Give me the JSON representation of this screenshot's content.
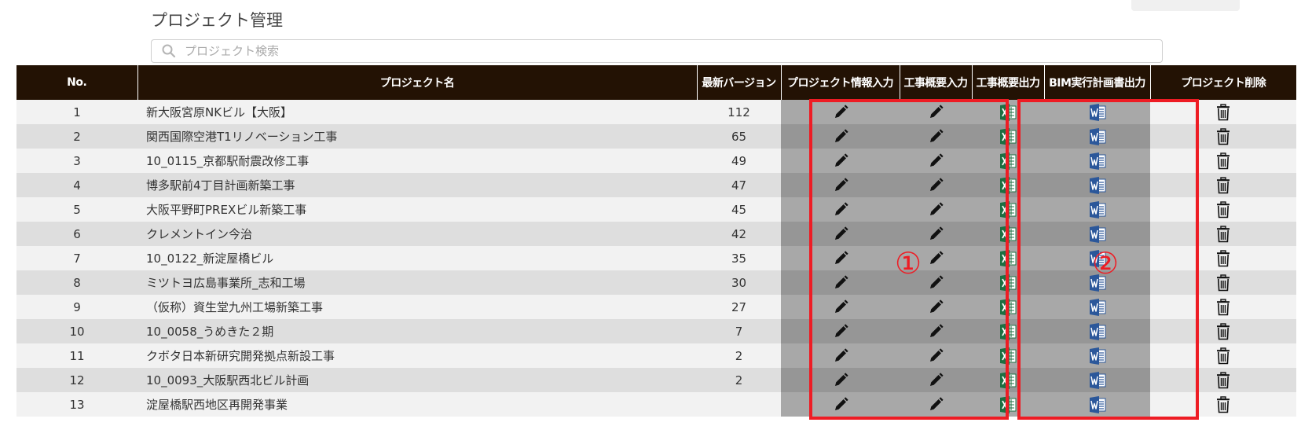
{
  "page": {
    "title": "プロジェクト管理"
  },
  "search": {
    "placeholder": "プロジェクト検索",
    "value": ""
  },
  "table": {
    "headers": {
      "no": "No.",
      "name": "プロジェクト名",
      "version": "最新バージョン",
      "project_info_input": "プロジェクト情報入力",
      "summary_input": "工事概要入力",
      "summary_output": "工事概要出力",
      "bim_plan_output": "BIM実行計画書出力",
      "delete": "プロジェクト削除"
    },
    "rows": [
      {
        "no": "1",
        "name": "新大阪宮原NKビル【大阪】",
        "version": "112"
      },
      {
        "no": "2",
        "name": "関西国際空港T1リノベーション工事",
        "version": "65"
      },
      {
        "no": "3",
        "name": "10_0115_京都駅耐震改修工事",
        "version": "49"
      },
      {
        "no": "4",
        "name": "博多駅前4丁目計画新築工事",
        "version": "47"
      },
      {
        "no": "5",
        "name": "大阪平野町PREXビル新築工事",
        "version": "45"
      },
      {
        "no": "6",
        "name": "クレメントイン今治",
        "version": "42"
      },
      {
        "no": "7",
        "name": "10_0122_新淀屋橋ビル",
        "version": "35"
      },
      {
        "no": "8",
        "name": "ミツトヨ広島事業所_志和工場",
        "version": "30"
      },
      {
        "no": "9",
        "name": "（仮称）資生堂九州工場新築工事",
        "version": "27"
      },
      {
        "no": "10",
        "name": "10_0058_うめきた２期",
        "version": "7"
      },
      {
        "no": "11",
        "name": "クボタ日本新研究開発拠点新設工事",
        "version": "2"
      },
      {
        "no": "12",
        "name": "10_0093_大阪駅西北ビル計画",
        "version": "2"
      },
      {
        "no": "13",
        "name": "淀屋橋駅西地区再開発事業",
        "version": ""
      }
    ]
  },
  "annotations": {
    "label_1": "①",
    "label_2": "②",
    "color": "#ee1c24"
  },
  "icons": {
    "search": "search-icon",
    "edit": "pencil-icon",
    "excel": "excel-icon",
    "word": "word-icon",
    "delete": "trash-icon"
  },
  "colors": {
    "header_bg": "#231204",
    "row_light": "#f2f2f2",
    "row_dark": "#dedede",
    "highlight_light": "#a8a8a8",
    "highlight_dark": "#969696",
    "excel_green": "#1d6f42",
    "word_blue": "#2b579a"
  }
}
